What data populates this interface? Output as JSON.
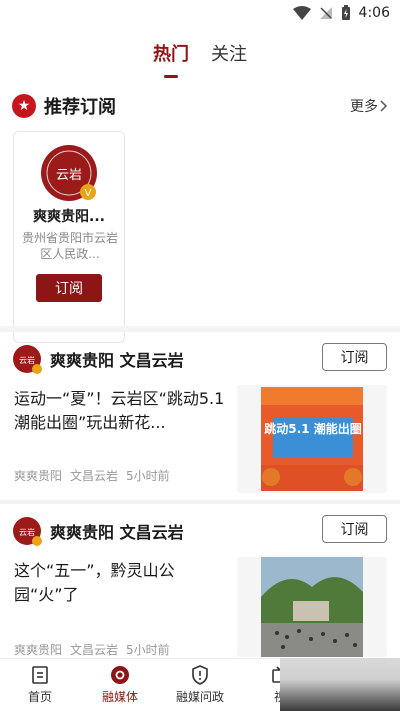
{
  "status_bar": {
    "time": "4:06"
  },
  "tabs": [
    {
      "label": "热门",
      "active": true
    },
    {
      "label": "关注",
      "active": false
    }
  ],
  "recommend": {
    "title": "推荐订阅",
    "more": "更多",
    "card": {
      "name": "爽爽贵阳...",
      "desc": "贵州省贵阳市云岩区人民政...",
      "subscribe": "订阅",
      "logo_text": "云岩"
    }
  },
  "news": [
    {
      "author": "爽爽贵阳 文昌云岩",
      "subscribe": "订阅",
      "title": "运动一“夏”！云岩区“跳动5.1 潮能出圈”玩出新花...",
      "meta_source": "爽爽贵阳",
      "meta_channel": "文昌云岩",
      "meta_time": "5小时前",
      "thumb_text": "跳动5.1 潮能出圈"
    },
    {
      "author": "爽爽贵阳 文昌云岩",
      "subscribe": "订阅",
      "title": "这个“五一”，黔灵山公园“火”了",
      "meta_source": "爽爽贵阳",
      "meta_channel": "文昌云岩",
      "meta_time": "5小时前"
    }
  ],
  "bottom_nav": [
    {
      "label": "首页",
      "icon": "home-icon",
      "active": false
    },
    {
      "label": "融媒体",
      "icon": "media-icon",
      "active": true
    },
    {
      "label": "融媒问政",
      "icon": "shield-icon",
      "active": false
    },
    {
      "label": "视",
      "icon": "video-icon",
      "active": false
    }
  ],
  "colors": {
    "brand": "#8c1515",
    "badge": "#c4161c"
  }
}
